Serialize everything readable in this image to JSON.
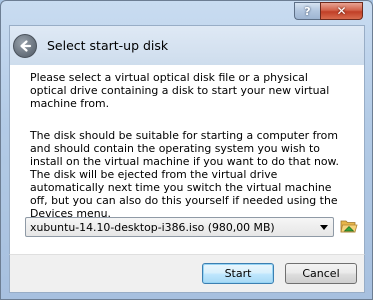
{
  "titlebar": {
    "help_label": "?",
    "close_label": "✕"
  },
  "header": {
    "title": "Select start-up disk"
  },
  "body": {
    "paragraph1": "Please select a virtual optical disk file or a physical optical drive containing a disk to start your new virtual machine from.",
    "paragraph2": "The disk should be suitable for starting a computer from and should contain the operating system you wish to install on the virtual machine if you want to do that now. The disk will be ejected from the virtual drive automatically next time you switch the virtual machine off, but you can also do this yourself if needed using the Devices menu."
  },
  "disk_select": {
    "selected": "xubuntu-14.10-desktop-i386.iso (980,00 MB)"
  },
  "buttons": {
    "start": "Start",
    "cancel": "Cancel"
  },
  "colors": {
    "accent": "#3c7fb1",
    "window_frame": "#b3cbe6",
    "close_button": "#c13f27"
  },
  "icons": {
    "back": "back-arrow-icon",
    "folder": "folder-open-icon",
    "dropdown": "chevron-down-icon"
  }
}
